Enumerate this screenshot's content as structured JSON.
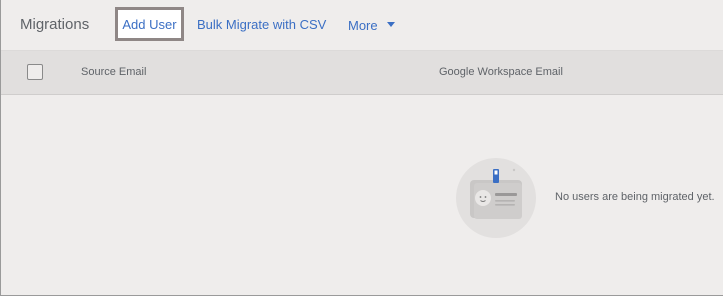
{
  "toolbar": {
    "title": "Migrations",
    "add_user_label": "Add User",
    "bulk_label": "Bulk Migrate with CSV",
    "more_label": "More"
  },
  "table": {
    "columns": [
      "Source Email",
      "Google Workspace Email"
    ]
  },
  "empty_state": {
    "message": "No users are being migrated yet.",
    "icon": "id-badge-icon"
  },
  "colors": {
    "accent": "#3b6fc4",
    "background": "#efedec",
    "header_background": "#e1dfde"
  }
}
